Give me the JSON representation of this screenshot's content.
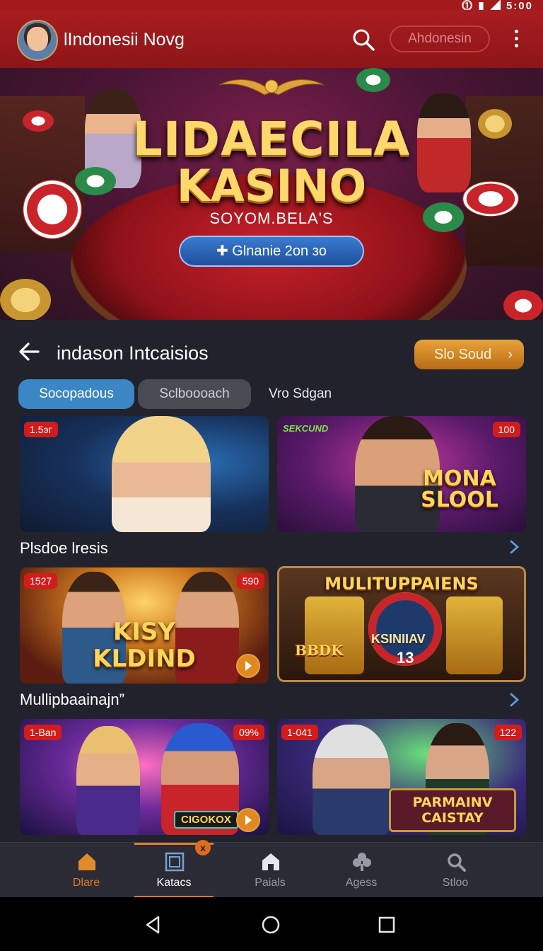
{
  "status_bar": {
    "time": "5:00"
  },
  "app_bar": {
    "title": "lIndonesii Novg",
    "language_button": "Ahdonesin"
  },
  "hero": {
    "title_line1": "LIDAECILA",
    "title_line2": "KASINO",
    "subtitle": "SOYOM.BELA'S",
    "cta_label": "Glnanie 2on зo"
  },
  "section": {
    "title": "indason Intcaisios",
    "action_label": "Slo Soud"
  },
  "tabs": [
    {
      "label": "Socopadous",
      "active": true
    },
    {
      "label": "Sclboooach",
      "active": false
    },
    {
      "label": "Vro Sdgan",
      "active": false
    }
  ],
  "rows": [
    {
      "cards": [
        {
          "badge": "1.5эг",
          "heading": ""
        },
        {
          "badge": "100",
          "tag": "SEKCUND",
          "heading": "MONA SLOOL"
        }
      ]
    },
    {
      "label": "Plsdoe lresis",
      "cards": [
        {
          "badge": "1527",
          "badge2": "590",
          "heading": "KISY KLDIND"
        },
        {
          "heading": "MULITUPPAIENS",
          "inner": [
            "BBDK",
            "KSINIIAV",
            "13"
          ]
        }
      ]
    },
    {
      "label": "Mullipbaainajn”",
      "cards": [
        {
          "badge": "1-Ban",
          "badge2": "09%",
          "heading": "CIGOKOX"
        },
        {
          "badge": "1-041",
          "badge2": "122",
          "heading": "PARMAINV CAISTAY"
        }
      ]
    }
  ],
  "bottom_nav": [
    {
      "label": "Dlare",
      "icon": "home-icon",
      "color": "#e07b2a"
    },
    {
      "label": "Katacs",
      "icon": "square-icon",
      "badge": "x",
      "active": true
    },
    {
      "label": "Paials",
      "icon": "house-icon"
    },
    {
      "label": "Agess",
      "icon": "clover-icon"
    },
    {
      "label": "Stloo",
      "icon": "search-icon"
    }
  ]
}
